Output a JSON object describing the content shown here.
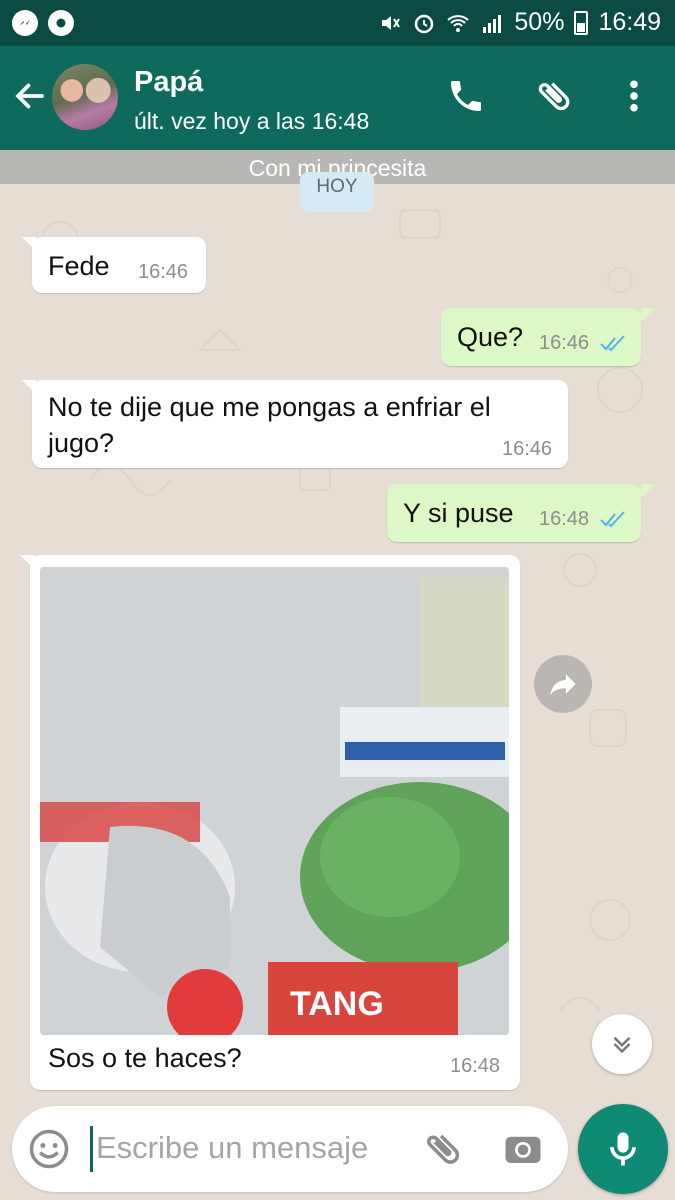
{
  "status_bar": {
    "battery": "50%",
    "time": "16:49"
  },
  "header": {
    "contact_name": "Papá",
    "last_seen": "últ. vez hoy a las 16:48"
  },
  "chat": {
    "banner": "Con mi princesita",
    "date_chip": "HOY",
    "messages": [
      {
        "dir": "in",
        "text": "Fede",
        "time": "16:46"
      },
      {
        "dir": "out",
        "text": "Que?",
        "time": "16:46",
        "read": true
      },
      {
        "dir": "in",
        "text_line1": "No te dije que me pongas a enfriar el",
        "text_line2": "jugo?",
        "time": "16:46"
      },
      {
        "dir": "out",
        "text": "Y si puse",
        "time": "16:48",
        "read": true
      },
      {
        "dir": "in",
        "caption": "Sos o te haces?",
        "time": "16:48",
        "photo_text": "TANG"
      }
    ]
  },
  "composer": {
    "placeholder": "Escribe un mensaje"
  },
  "colors": {
    "header": "#0e6a5c",
    "statusbar": "#0b4b43",
    "outgoing": "#dcf8c6",
    "mic": "#0e8a75",
    "read_ticks": "#4fb6ec"
  },
  "icons": [
    "messenger-icon",
    "chat-icon",
    "mute-icon",
    "alarm-icon",
    "wifi-icon",
    "signal-icon",
    "battery-icon",
    "back-arrow-icon",
    "phone-icon",
    "paperclip-icon",
    "more-vert-icon",
    "forward-icon",
    "chevron-down-icon",
    "emoji-icon",
    "camera-icon",
    "mic-icon"
  ]
}
